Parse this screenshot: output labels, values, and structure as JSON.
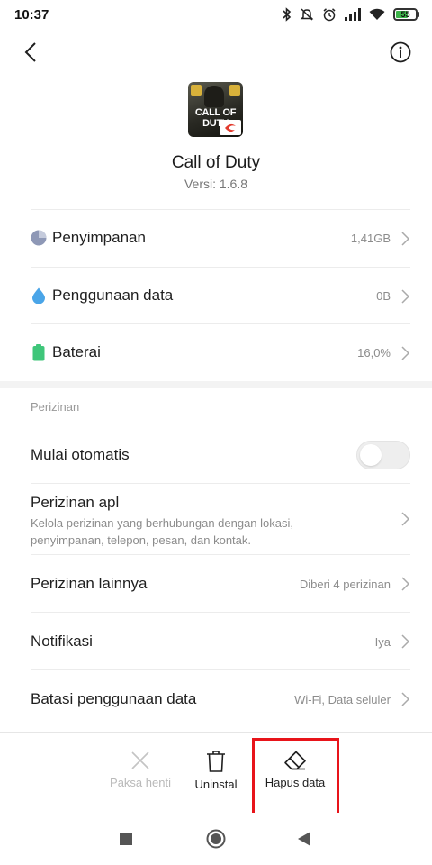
{
  "status_bar": {
    "time": "10:37",
    "battery_level": "55",
    "icons": [
      "bluetooth-icon",
      "mute-icon",
      "alarm-icon",
      "signal-icon",
      "wifi-icon",
      "battery-icon"
    ]
  },
  "header": {
    "back_icon": "chevron-left-icon",
    "info_icon": "info-icon"
  },
  "app": {
    "icon_text": "CALL OF DUTY",
    "name": "Call of Duty",
    "version": "Versi: 1.6.8"
  },
  "usage_rows": [
    {
      "icon": "pie-chart-icon",
      "title": "Penyimpanan",
      "value": "1,41GB",
      "icon_color": "#8e98b6"
    },
    {
      "icon": "water-drop-icon",
      "title": "Penggunaan data",
      "value": "0B",
      "icon_color": "#4aa5e8"
    },
    {
      "icon": "battery-icon",
      "title": "Baterai",
      "value": "16,0%",
      "icon_color": "#3fc67a"
    }
  ],
  "permissions": {
    "section_label": "Perizinan",
    "autostart": {
      "title": "Mulai otomatis",
      "enabled": false
    },
    "app_permissions": {
      "title": "Perizinan apl",
      "subtitle_line1": "Kelola perizinan yang berhubungan dengan lokasi,",
      "subtitle_line2": "penyimpanan, telepon, pesan, dan kontak."
    },
    "other_permissions": {
      "title": "Perizinan lainnya",
      "value": "Diberi 4 perizinan"
    },
    "notifications": {
      "title": "Notifikasi",
      "value": "Iya"
    },
    "data_limit": {
      "title": "Batasi penggunaan data",
      "value": "Wi-Fi, Data seluler"
    }
  },
  "actions": {
    "force_stop": {
      "label": "Paksa henti",
      "icon": "close-icon",
      "enabled": false
    },
    "uninstall": {
      "label": "Uninstal",
      "icon": "trash-icon",
      "enabled": true
    },
    "clear_data": {
      "label": "Hapus data",
      "icon": "eraser-icon",
      "enabled": true
    }
  },
  "nav_bar": {
    "icons": [
      "recents-square-icon",
      "home-circle-icon",
      "back-triangle-icon"
    ]
  },
  "colors": {
    "highlight": "#e8141a",
    "battery_green": "#3db54a"
  }
}
